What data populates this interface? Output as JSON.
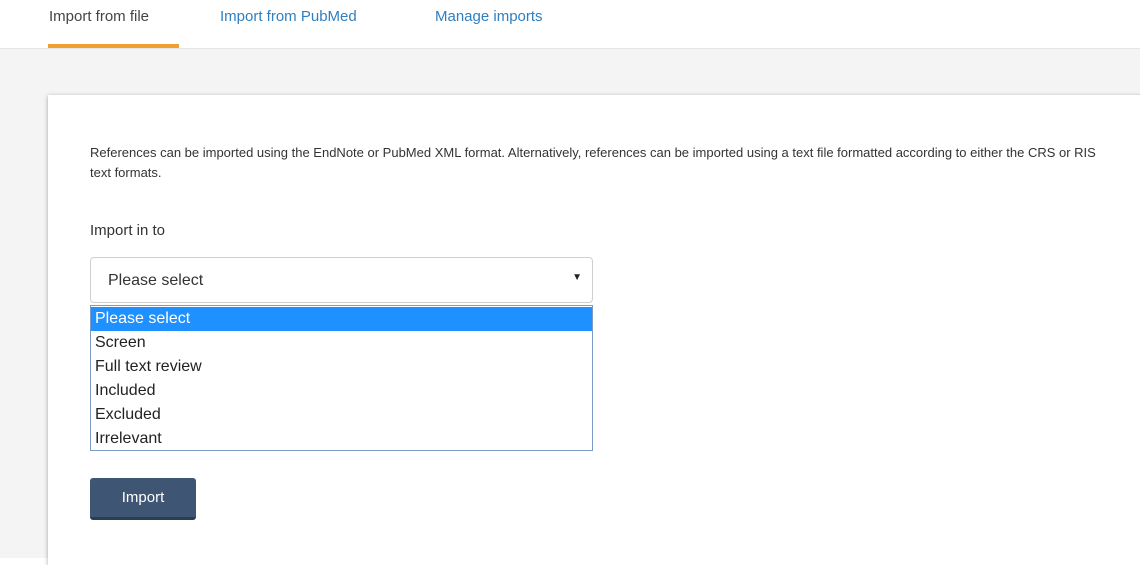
{
  "tabs": [
    {
      "label": "Import from file",
      "active": true
    },
    {
      "label": "Import from PubMed",
      "active": false
    },
    {
      "label": "Manage imports",
      "active": false
    }
  ],
  "panel": {
    "description": "References can be imported using the EndNote or PubMed XML format. Alternatively, references can be imported using a text file formatted according to either the CRS or RIS text formats.",
    "import_label": "Import in to",
    "select": {
      "value": "Please select",
      "caret_icon": "caret-down-icon",
      "options": [
        "Please select",
        "Screen",
        "Full text review",
        "Included",
        "Excluded",
        "Irrelevant"
      ],
      "highlighted_option": "Please select"
    },
    "import_button_label": "Import"
  },
  "colors": {
    "link": "#2f7fc0",
    "active_tab_underline": "#f0a030",
    "option_highlight": "#1e90ff",
    "button_bg": "#3f5574"
  }
}
